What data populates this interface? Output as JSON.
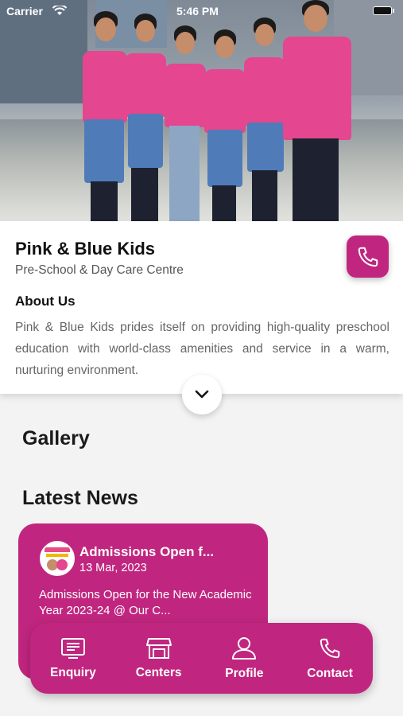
{
  "status": {
    "carrier": "Carrier",
    "time": "5:46 PM"
  },
  "school": {
    "name": "Pink & Blue Kids",
    "subtitle": "Pre-School & Day Care Centre",
    "about_heading": "About Us",
    "about_text": "Pink & Blue Kids prides itself on providing high-quality preschool education with world-class amenities and service in a warm, nurturing environment."
  },
  "sections": {
    "gallery": "Gallery",
    "news": "Latest News"
  },
  "news": [
    {
      "title": "Admissions Open f...",
      "date": "13 Mar, 2023",
      "body": "Admissions Open for the New Academic Year 2023-24 @ Our C..."
    }
  ],
  "nav": [
    {
      "label": "Enquiry",
      "icon": "enquiry-icon"
    },
    {
      "label": "Centers",
      "icon": "store-icon"
    },
    {
      "label": "Profile",
      "icon": "profile-icon"
    },
    {
      "label": "Contact",
      "icon": "phone-icon"
    }
  ],
  "colors": {
    "brand": "#c0267f",
    "background": "#f3f3f4"
  }
}
